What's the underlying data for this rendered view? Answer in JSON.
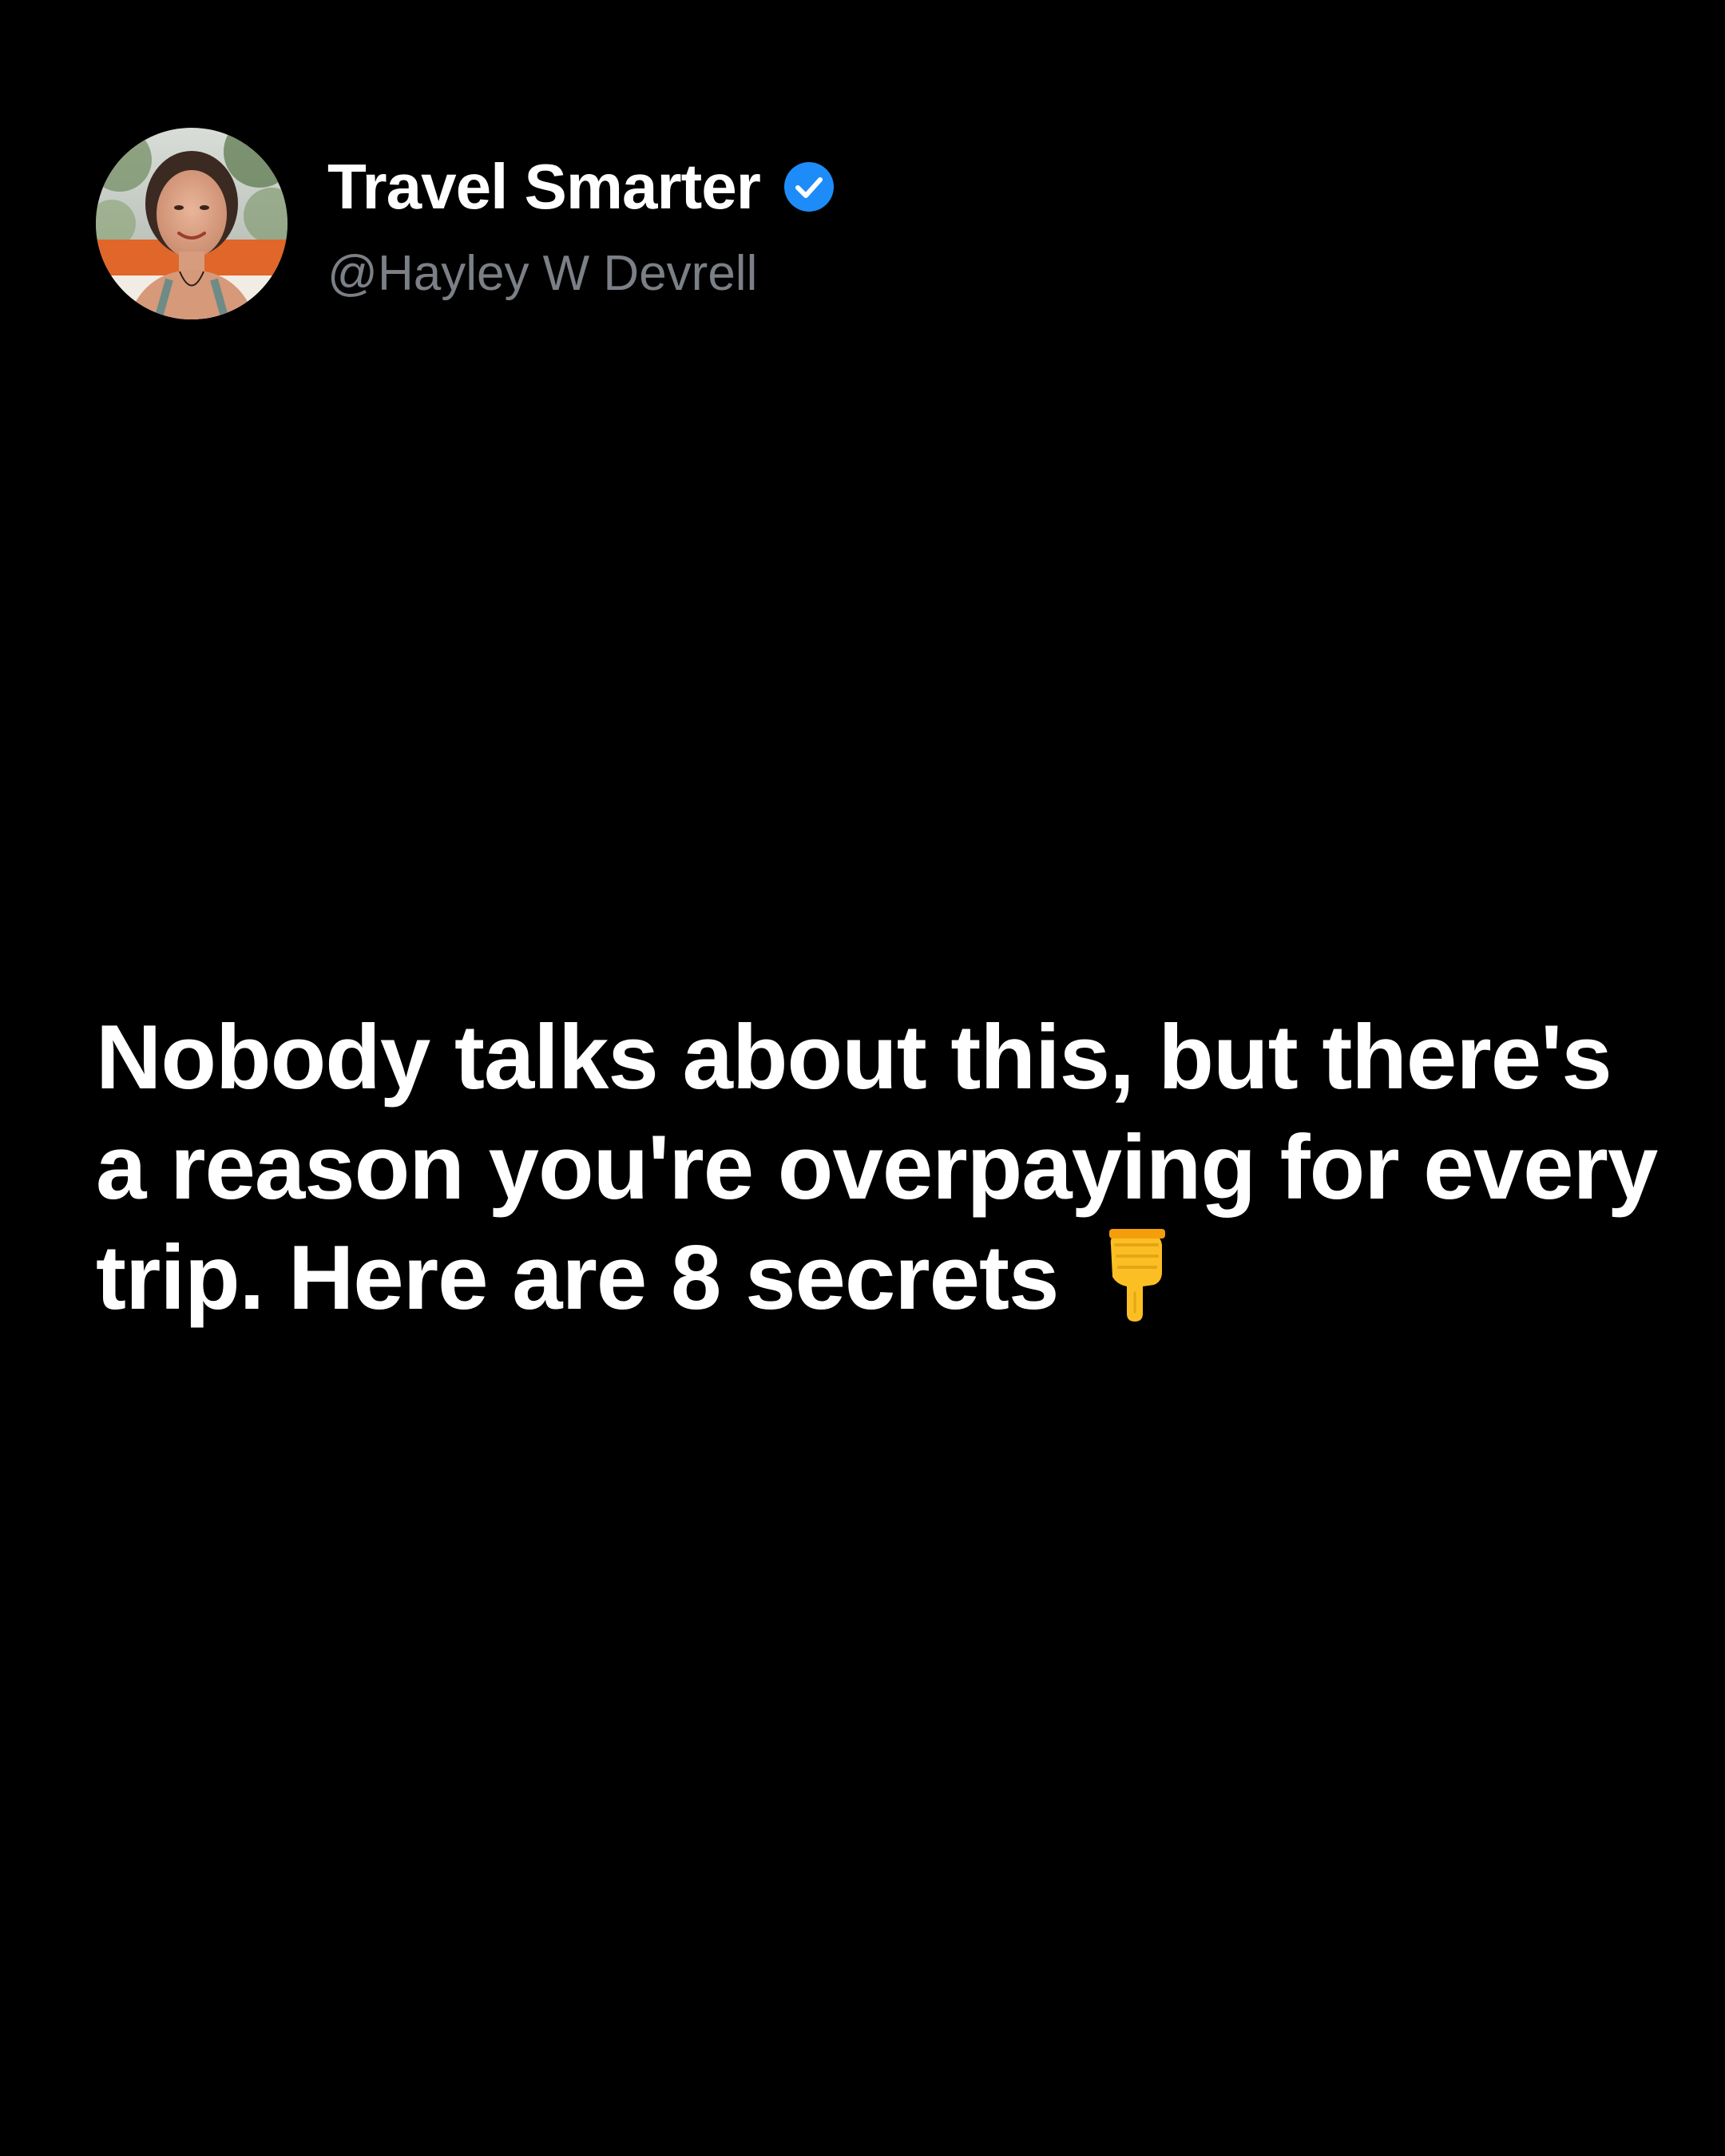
{
  "post": {
    "author": {
      "display_name": "Travel Smarter",
      "handle": "@Hayley W Devrell",
      "verified": true,
      "avatar_icon": "profile-photo",
      "badge_icon": "verified-badge-icon"
    },
    "text": "Nobody talks about this, but there's a reason you're overpaying for every trip. Here are 8 secrets",
    "emoji_icon": "backhand-index-pointing-down-icon"
  },
  "colors": {
    "background": "#000000",
    "text_primary": "#ffffff",
    "text_secondary": "#7b7f86",
    "verified_blue": "#1d8cf8",
    "emoji_yellow": "#fbbf24"
  }
}
